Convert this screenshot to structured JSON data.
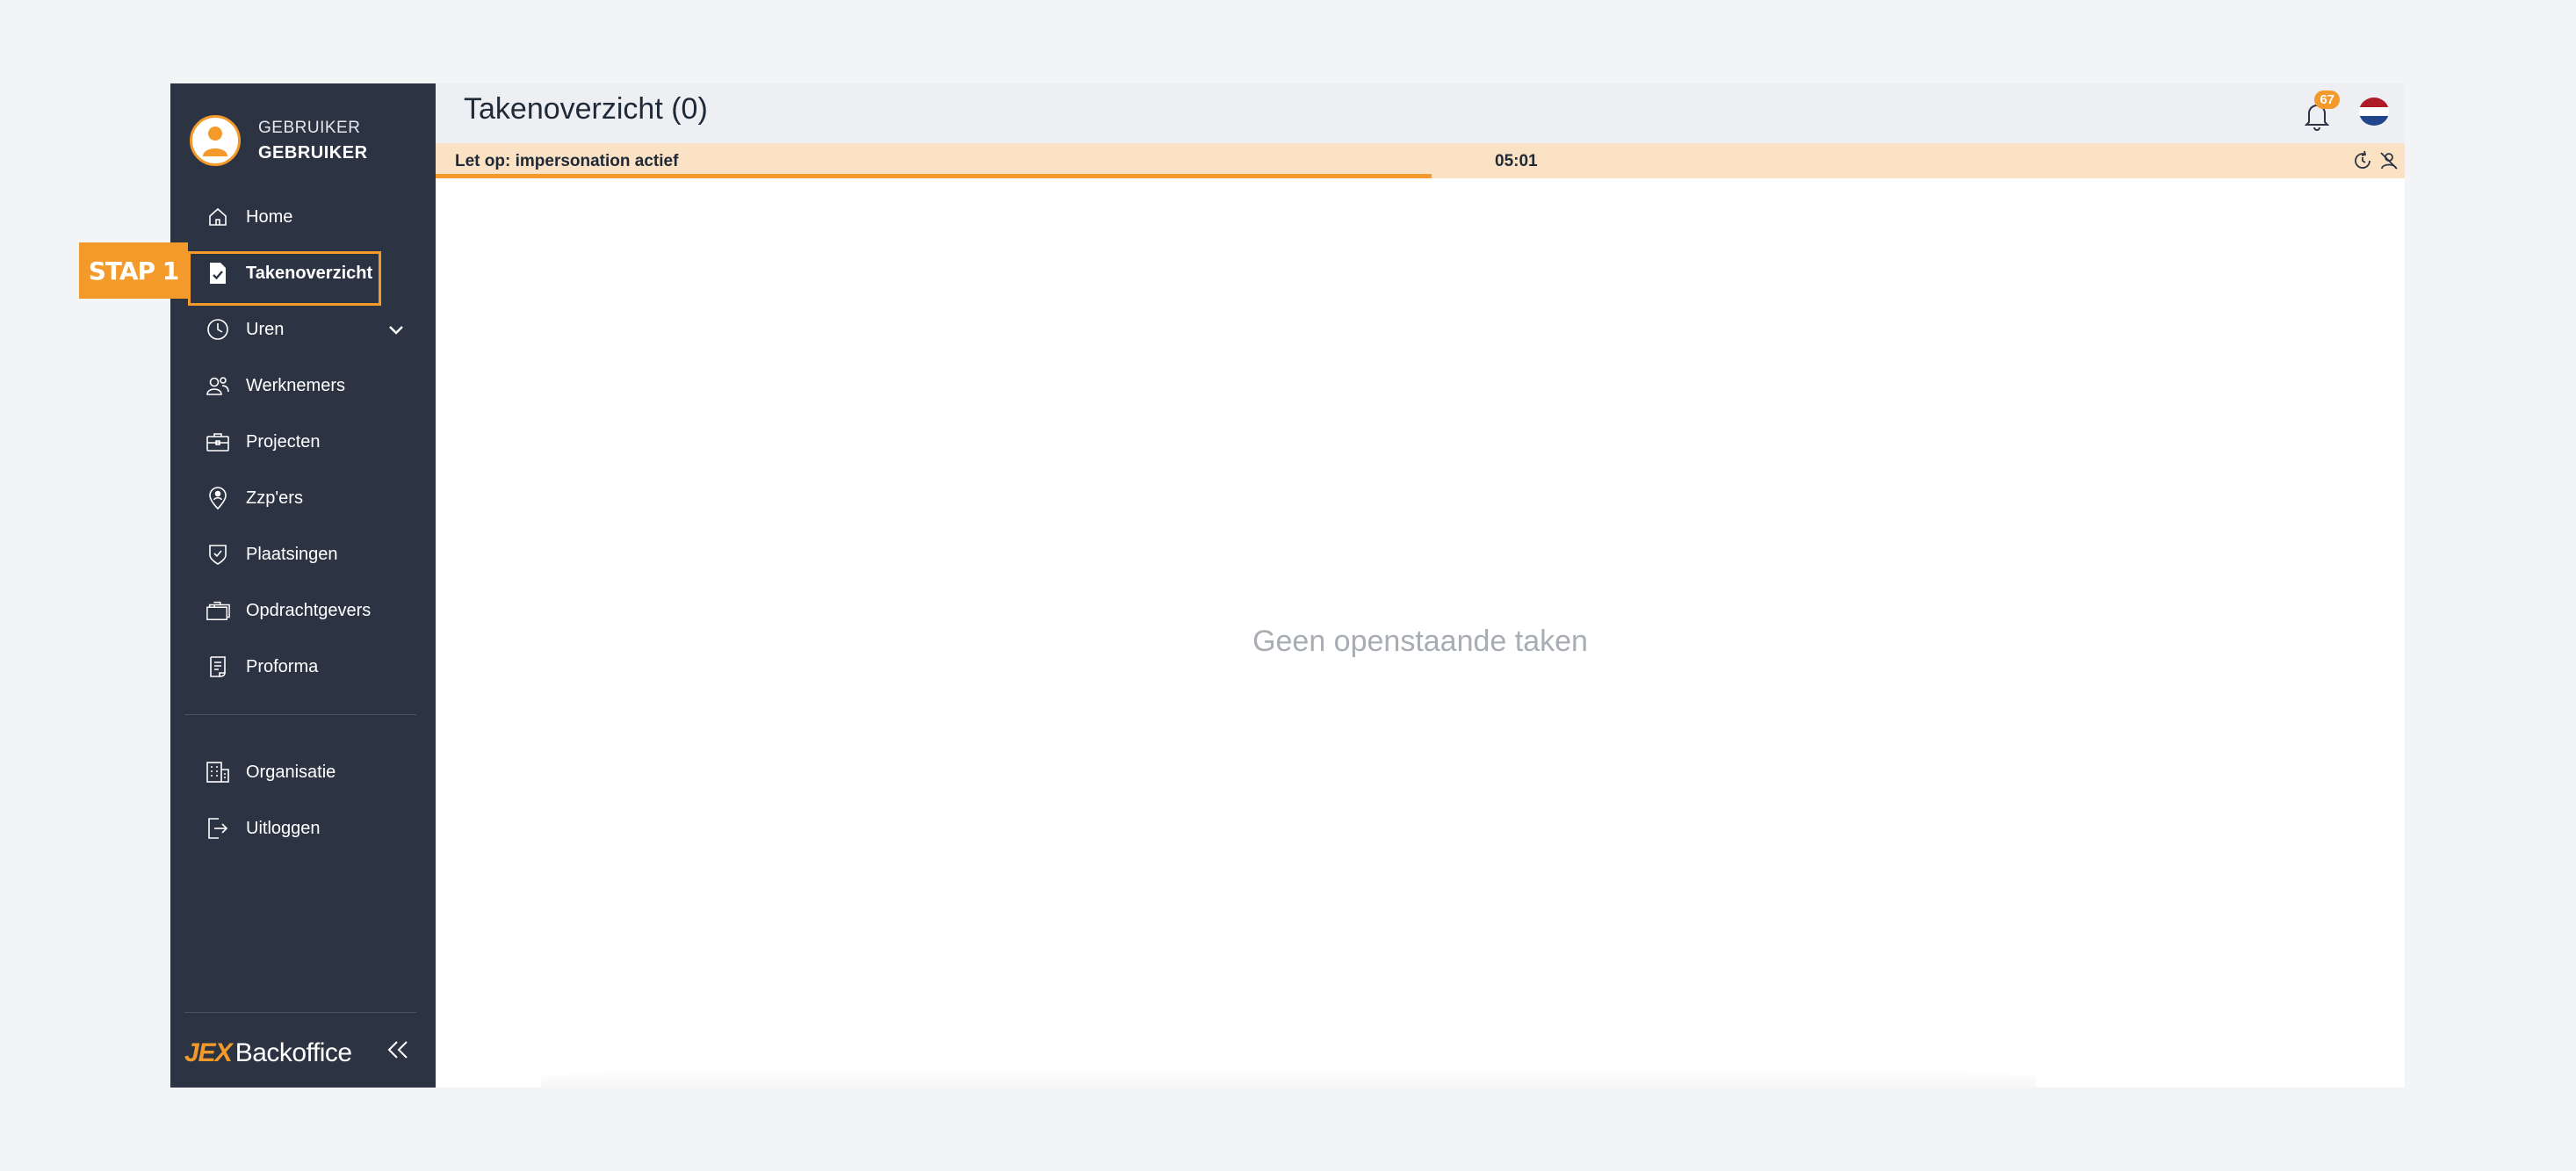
{
  "user": {
    "role": "GEBRUIKER",
    "name": "GEBRUIKER"
  },
  "nav": {
    "items": [
      {
        "label": "Home"
      },
      {
        "label": "Takenoverzicht"
      },
      {
        "label": "Uren"
      },
      {
        "label": "Werknemers"
      },
      {
        "label": "Projecten"
      },
      {
        "label": "Zzp'ers"
      },
      {
        "label": "Plaatsingen"
      },
      {
        "label": "Opdrachtgevers"
      },
      {
        "label": "Proforma"
      }
    ],
    "secondary": [
      {
        "label": "Organisatie"
      },
      {
        "label": "Uitloggen"
      }
    ]
  },
  "brand": {
    "mark": "JEX",
    "text": "Backoffice"
  },
  "callout": {
    "label": "STAP 1"
  },
  "header": {
    "title": "Takenoverzicht (0)",
    "notification_count": "67"
  },
  "impersonation": {
    "message": "Let op: impersonation actief",
    "timer": "05:01",
    "progress": 0.506
  },
  "main": {
    "empty_message": "Geen openstaande taken"
  },
  "colors": {
    "accent": "#f39a2a",
    "sidebar": "#2c3444",
    "banner": "#fbe2c5"
  }
}
